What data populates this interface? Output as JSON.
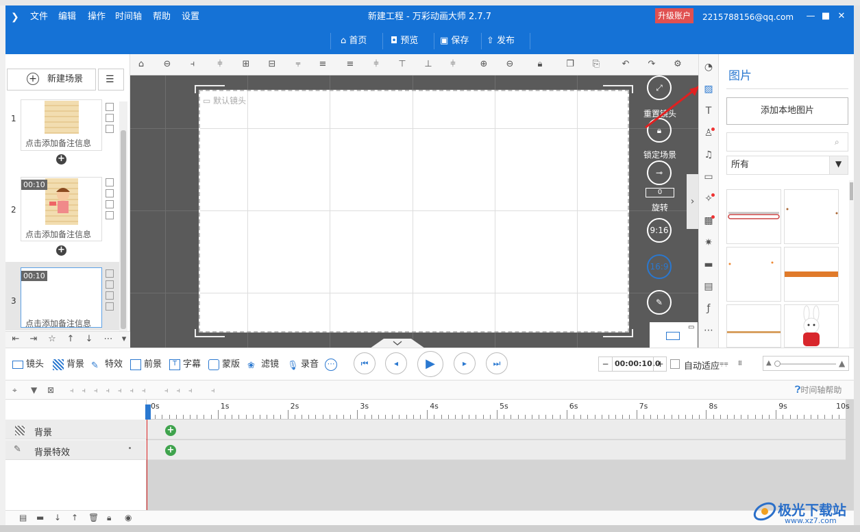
{
  "window": {
    "menu": [
      "文件",
      "编辑",
      "操作",
      "时间轴",
      "帮助",
      "设置"
    ],
    "title": "新建工程 - 万彩动画大师 2.7.7",
    "upgrade": "升级账户",
    "user": "2215788156@qq.com",
    "nav": [
      "首页",
      "预览",
      "保存",
      "发布"
    ]
  },
  "scenes": {
    "new_scene": "新建场景",
    "items": [
      {
        "num": "1",
        "note": "点击添加备注信息",
        "time": ""
      },
      {
        "num": "2",
        "note": "点击添加备注信息",
        "time": "00:10"
      },
      {
        "num": "3",
        "note": "点击添加备注信息",
        "time": "00:10"
      }
    ]
  },
  "canvas": {
    "default_camera": "默认镜头",
    "reset_camera": "重置镜头",
    "lock_scene": "锁定场景",
    "rotate_value": "0",
    "rotate": "旋转",
    "ratio_916": "9:16",
    "ratio_169": "16:9"
  },
  "image_panel": {
    "title": "图片",
    "add_local": "添加本地图片",
    "search_placeholder": "",
    "filter": "所有"
  },
  "timeline": {
    "buttons": [
      "镜头",
      "背景",
      "特效",
      "前景",
      "字幕",
      "蒙版",
      "滤镜",
      "录音"
    ],
    "time": "00:00:10.0",
    "auto_fit": "自动适应",
    "help": "时间轴帮助",
    "ticks": [
      "0s",
      "1s",
      "2s",
      "3s",
      "4s",
      "5s",
      "6s",
      "7s",
      "8s",
      "9s",
      "10s"
    ],
    "tracks": [
      "背景",
      "背景特效"
    ]
  },
  "watermark": {
    "name": "极光下载站",
    "url": "www.xz7.com"
  },
  "colors": {
    "brand": "#1572d6",
    "canvas_bg": "#5a5a5a",
    "keyframe": "#3fa34d",
    "playhead": "#dd2222",
    "upgrade": "#e05050"
  }
}
